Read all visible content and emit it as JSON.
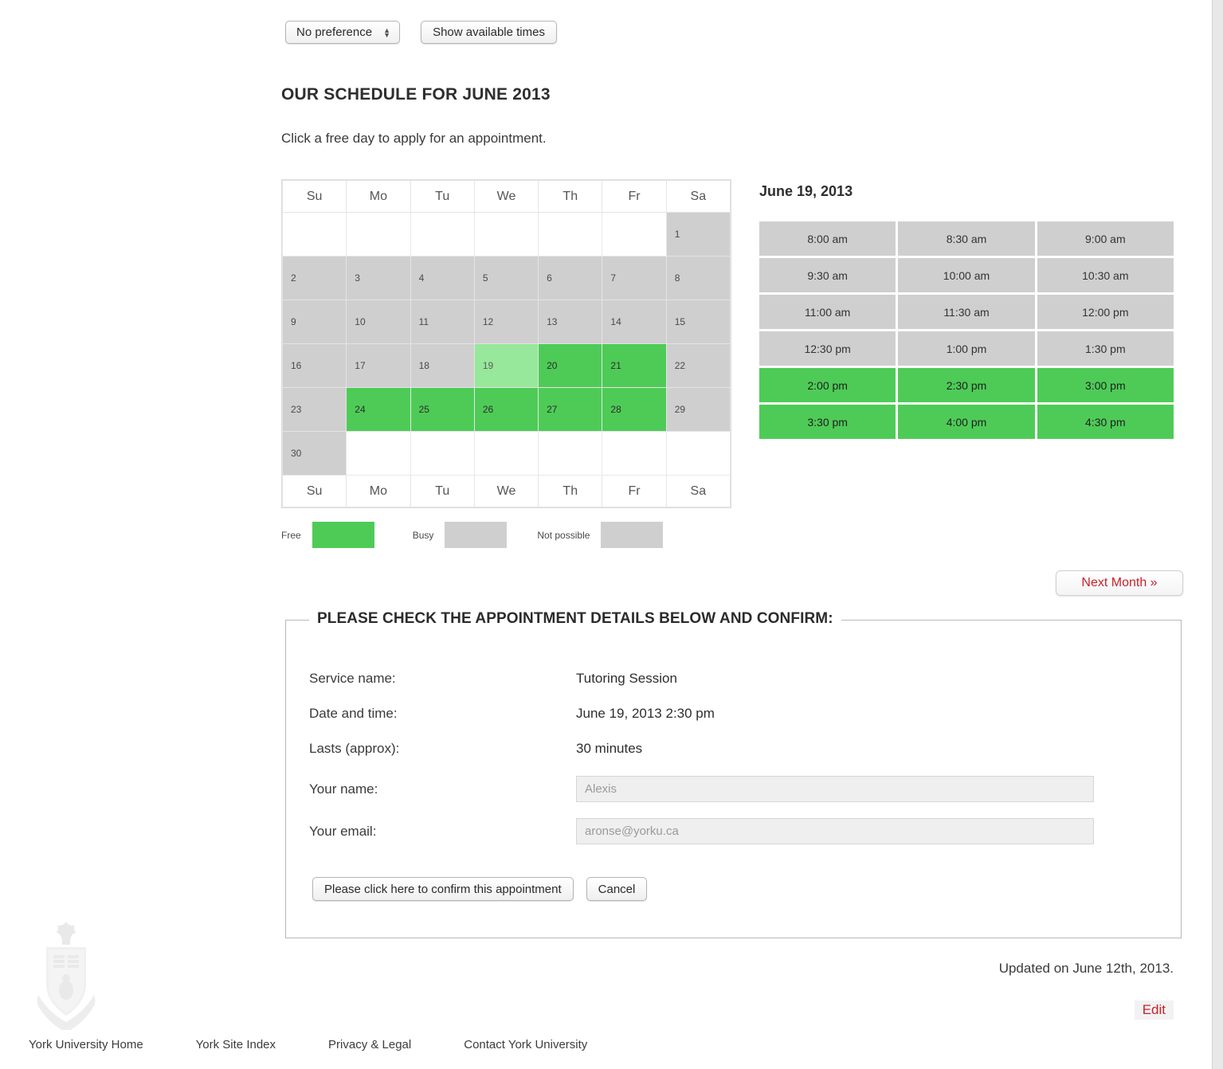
{
  "toolbar": {
    "preference_select": "No preference",
    "show_times_button": "Show available times"
  },
  "schedule": {
    "title": "OUR SCHEDULE FOR JUNE 2013",
    "subtitle": "Click a free day to apply for an appointment.",
    "weekdays": [
      "Su",
      "Mo",
      "Tu",
      "We",
      "Th",
      "Fr",
      "Sa"
    ],
    "weeks": [
      [
        {
          "day": "",
          "state": "blank"
        },
        {
          "day": "",
          "state": "blank"
        },
        {
          "day": "",
          "state": "blank"
        },
        {
          "day": "",
          "state": "blank"
        },
        {
          "day": "",
          "state": "blank"
        },
        {
          "day": "",
          "state": "blank"
        },
        {
          "day": "1",
          "state": "busy"
        }
      ],
      [
        {
          "day": "2",
          "state": "busy"
        },
        {
          "day": "3",
          "state": "busy"
        },
        {
          "day": "4",
          "state": "busy"
        },
        {
          "day": "5",
          "state": "busy"
        },
        {
          "day": "6",
          "state": "busy"
        },
        {
          "day": "7",
          "state": "busy"
        },
        {
          "day": "8",
          "state": "busy"
        }
      ],
      [
        {
          "day": "9",
          "state": "busy"
        },
        {
          "day": "10",
          "state": "busy"
        },
        {
          "day": "11",
          "state": "busy"
        },
        {
          "day": "12",
          "state": "busy"
        },
        {
          "day": "13",
          "state": "busy"
        },
        {
          "day": "14",
          "state": "busy"
        },
        {
          "day": "15",
          "state": "busy"
        }
      ],
      [
        {
          "day": "16",
          "state": "busy"
        },
        {
          "day": "17",
          "state": "busy"
        },
        {
          "day": "18",
          "state": "busy"
        },
        {
          "day": "19",
          "state": "selected"
        },
        {
          "day": "20",
          "state": "free"
        },
        {
          "day": "21",
          "state": "free"
        },
        {
          "day": "22",
          "state": "busy"
        }
      ],
      [
        {
          "day": "23",
          "state": "busy"
        },
        {
          "day": "24",
          "state": "free"
        },
        {
          "day": "25",
          "state": "free"
        },
        {
          "day": "26",
          "state": "free"
        },
        {
          "day": "27",
          "state": "free"
        },
        {
          "day": "28",
          "state": "free"
        },
        {
          "day": "29",
          "state": "busy"
        }
      ],
      [
        {
          "day": "30",
          "state": "busy"
        },
        {
          "day": "",
          "state": "blank"
        },
        {
          "day": "",
          "state": "blank"
        },
        {
          "day": "",
          "state": "blank"
        },
        {
          "day": "",
          "state": "blank"
        },
        {
          "day": "",
          "state": "blank"
        },
        {
          "day": "",
          "state": "blank"
        }
      ]
    ]
  },
  "legend": {
    "free_label": "Free",
    "busy_label": "Busy",
    "not_possible_label": "Not possible",
    "free_color": "#4ecb57",
    "busy_color": "#cfcfcf",
    "not_possible_color": "#cfcfcf"
  },
  "slots": {
    "date_title": "June 19, 2013",
    "items": [
      {
        "time": "8:00 am",
        "state": "busy"
      },
      {
        "time": "8:30 am",
        "state": "busy"
      },
      {
        "time": "9:00 am",
        "state": "busy"
      },
      {
        "time": "9:30 am",
        "state": "busy"
      },
      {
        "time": "10:00 am",
        "state": "busy"
      },
      {
        "time": "10:30 am",
        "state": "busy"
      },
      {
        "time": "11:00 am",
        "state": "busy"
      },
      {
        "time": "11:30 am",
        "state": "busy"
      },
      {
        "time": "12:00 pm",
        "state": "busy"
      },
      {
        "time": "12:30 pm",
        "state": "busy"
      },
      {
        "time": "1:00 pm",
        "state": "busy"
      },
      {
        "time": "1:30 pm",
        "state": "busy"
      },
      {
        "time": "2:00 pm",
        "state": "free"
      },
      {
        "time": "2:30 pm",
        "state": "free"
      },
      {
        "time": "3:00 pm",
        "state": "free"
      },
      {
        "time": "3:30 pm",
        "state": "free"
      },
      {
        "time": "4:00 pm",
        "state": "free"
      },
      {
        "time": "4:30 pm",
        "state": "free"
      }
    ]
  },
  "next_month_button": "Next Month »",
  "confirm": {
    "legend": "PLEASE CHECK THE APPOINTMENT DETAILS BELOW AND CONFIRM:",
    "service_label": "Service name:",
    "service_value": "Tutoring Session",
    "datetime_label": "Date and time:",
    "datetime_value": "June 19, 2013 2:30 pm",
    "lasts_label": "Lasts (approx):",
    "lasts_value": "30 minutes",
    "name_label": "Your name:",
    "name_value": "Alexis",
    "email_label": "Your email:",
    "email_value": "aronse@yorku.ca",
    "confirm_button": "Please click here to confirm this appointment",
    "cancel_button": "Cancel"
  },
  "footer": {
    "updated": "Updated on June 12th, 2013.",
    "edit": "Edit",
    "links": [
      "York University Home",
      "York Site Index",
      "Privacy & Legal",
      "Contact York University"
    ]
  }
}
